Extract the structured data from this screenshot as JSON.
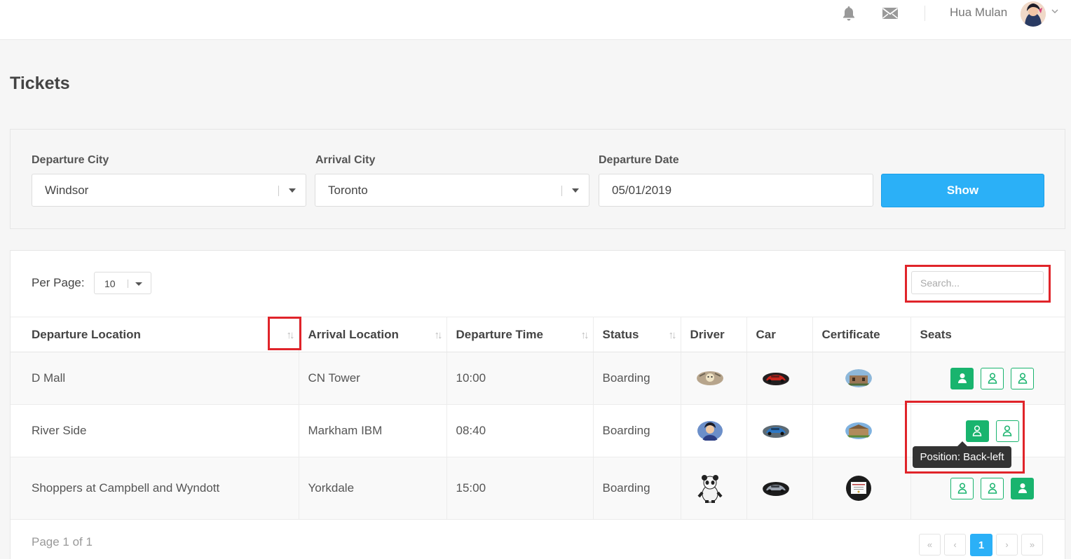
{
  "header": {
    "username": "Hua Mulan",
    "icons": [
      "bell-icon",
      "mail-icon",
      "chevron-down-icon"
    ]
  },
  "page_title": "Tickets",
  "filters": {
    "departure_city": {
      "label": "Departure City",
      "value": "Windsor"
    },
    "arrival_city": {
      "label": "Arrival City",
      "value": "Toronto"
    },
    "departure_date": {
      "label": "Departure Date",
      "value": "05/01/2019"
    },
    "show_label": "Show"
  },
  "list": {
    "per_page_label": "Per Page:",
    "per_page_value": "10",
    "search_placeholder": "Search...",
    "columns": [
      "Departure Location",
      "Arrival Location",
      "Departure Time",
      "Status",
      "Driver",
      "Car",
      "Certificate",
      "Seats"
    ],
    "rows": [
      {
        "departure": "D Mall",
        "arrival": "CN Tower",
        "time": "10:00",
        "status": "Boarding"
      },
      {
        "departure": "River Side",
        "arrival": "Markham IBM",
        "time": "08:40",
        "status": "Boarding"
      },
      {
        "departure": "Shoppers at Campbell and Wyndott",
        "arrival": "Yorkdale",
        "time": "15:00",
        "status": "Boarding"
      }
    ],
    "tooltip": "Position: Back-left",
    "page_info": "Page 1 of 1",
    "pagination": {
      "first": "«",
      "prev": "‹",
      "current": "1",
      "next": "›",
      "last": "»"
    }
  },
  "colors": {
    "accent": "#2bb0f7",
    "seat_green": "#19b46e",
    "highlight_red": "#e0242a"
  }
}
